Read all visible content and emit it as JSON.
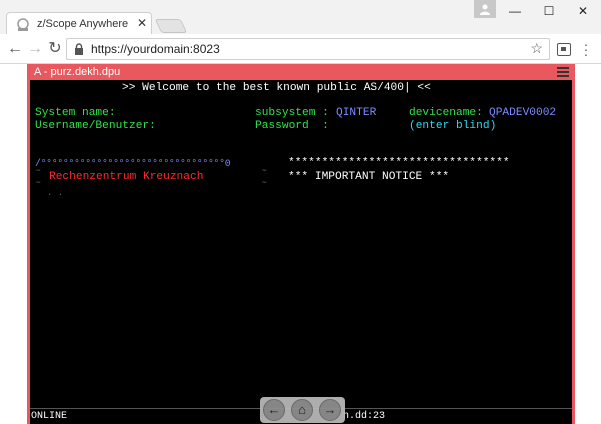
{
  "browser": {
    "tab_title": "z/Scope Anywhere",
    "tab_close": "✕",
    "url": "https://yourdomain:8023",
    "window_minimize": "—",
    "window_maximize": "☐",
    "window_close": "✕",
    "back_icon": "←",
    "forward_icon": "→",
    "reload_icon": "↻",
    "star_icon": "☆"
  },
  "terminal": {
    "title": "A - purz.dekh.dpu",
    "accent_color": "#e8585e",
    "lines": {
      "welcome": ">> Welcome to the best known public AS/400| <<",
      "system_name_label": "System name:",
      "subsystem_label": "subsystem :",
      "subsystem_value": "QINTER",
      "devicename_label": "devicename:",
      "devicename_value": "QPADEV0002",
      "username_label": "Username/Benutzer:",
      "password_label": "Password  :",
      "password_hint": "(enter blind)",
      "box_top": "/°°°°°°°°°°°°°°°°°°°°°°°°°°°°°°°°°0",
      "box_left_marks": "˜",
      "box_right_marks": "˜",
      "org_name": "Rechenzentrum Kreuznach",
      "dots": ". .",
      "stars": "*********************************",
      "notice": "*** IMPORTANT NOTICE ***"
    },
    "status": {
      "state": "ONLINE",
      "session": "h.dd:23"
    }
  },
  "navpad": {
    "back": "←",
    "home": "⌂",
    "forward": "→"
  }
}
